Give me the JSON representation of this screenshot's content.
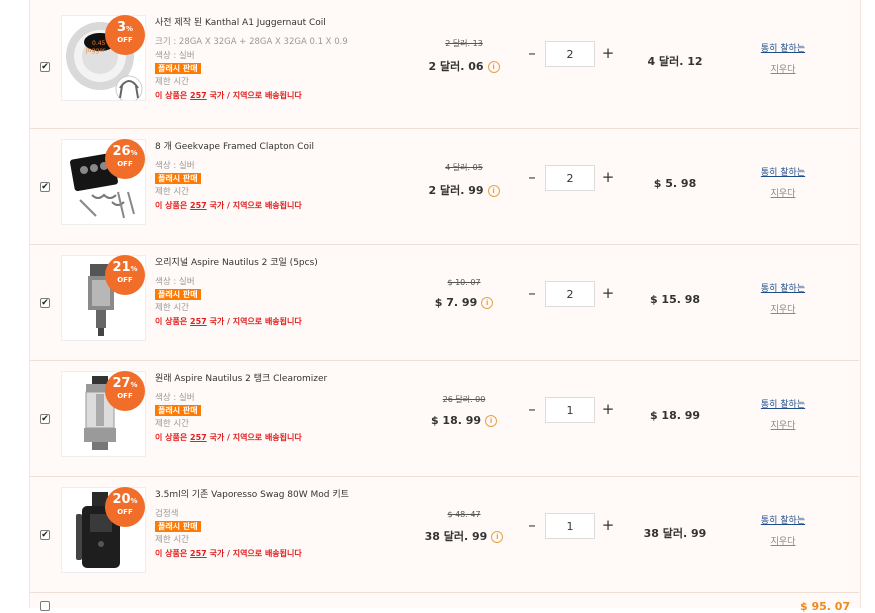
{
  "cart": {
    "items": [
      {
        "discount": "3",
        "pct_sign": "%",
        "off": "OFF",
        "title": "사전 제작 된 Kanthal A1 Juggernaut Coil",
        "meta": [
          "크기 : 28GA X 32GA + 28GA X 32GA 0.1 X 0.9",
          "색상 : 실버"
        ],
        "flash": "플래시 판매",
        "limit": "제한 시간",
        "ship_prefix": "이 상품은 ",
        "ship_count": "257",
        "ship_suffix": " 국가 / 지역으로 배송됩니다",
        "old_price": "2 달러. 13",
        "new_price": "2 달러. 06",
        "qty": "2",
        "subtotal": "4 달러. 12",
        "fav": "통히 찰하는",
        "del": "지우다",
        "checked": true,
        "icon": "coil-spool-icon"
      },
      {
        "discount": "26",
        "pct_sign": "%",
        "off": "OFF",
        "title": "8 개 Geekvape Framed Clapton Coil",
        "meta": [
          "색상 : 실버"
        ],
        "flash": "플래시 판매",
        "limit": "제한 시간",
        "ship_prefix": "이 상품은 ",
        "ship_count": "257",
        "ship_suffix": " 국가 / 지역으로 배송됩니다",
        "old_price": "4 달러. 05",
        "new_price": "2 달러. 99",
        "qty": "2",
        "subtotal": "$ 5. 98",
        "fav": "통히 찰하는",
        "del": "지우다",
        "checked": true,
        "icon": "clapton-coil-pack-icon"
      },
      {
        "discount": "21",
        "pct_sign": "%",
        "off": "OFF",
        "title": "오리지널 Aspire Nautilus 2 코일 (5pcs)",
        "meta": [
          "색상 : 실버"
        ],
        "flash": "플래시 판매",
        "limit": "제한 시간",
        "ship_prefix": "이 상품은 ",
        "ship_count": "257",
        "ship_suffix": " 국가 / 지역으로 배송됩니다",
        "old_price": "$ 10. 07",
        "new_price": "$ 7. 99",
        "qty": "2",
        "subtotal": "$ 15. 98",
        "fav": "통히 찰하는",
        "del": "지우다",
        "checked": true,
        "icon": "coil-head-icon"
      },
      {
        "discount": "27",
        "pct_sign": "%",
        "off": "OFF",
        "title": "원래 Aspire Nautilus 2 탱크 Clearomizer",
        "meta": [
          "색상 : 실버"
        ],
        "flash": "플래시 판매",
        "limit": "제한 시간",
        "ship_prefix": "이 상품은 ",
        "ship_count": "257",
        "ship_suffix": " 국가 / 지역으로 배송됩니다",
        "old_price": "26 달러. 00",
        "new_price": "$ 18. 99",
        "qty": "1",
        "subtotal": "$ 18. 99",
        "fav": "통히 찰하는",
        "del": "지우다",
        "checked": true,
        "icon": "clearomizer-tank-icon"
      },
      {
        "discount": "20",
        "pct_sign": "%",
        "off": "OFF",
        "title": "3.5ml의 기존 Vaporesso Swag 80W Mod 키트",
        "meta": [
          "검정색"
        ],
        "flash": "플래시 판매",
        "limit": "제한 시간",
        "ship_prefix": "이 상품은 ",
        "ship_count": "257",
        "ship_suffix": " 국가 / 지역으로 배송됩니다",
        "old_price": "$ 48. 47",
        "new_price": "38 달러. 99",
        "qty": "1",
        "subtotal": "38 달러. 99",
        "fav": "통히 찰하는",
        "del": "지우다",
        "checked": true,
        "icon": "mod-kit-icon"
      }
    ],
    "controls": {
      "minus": "–",
      "plus": "+",
      "checkmark": "✔",
      "info": "i"
    },
    "footer_total": "$ 95. 07"
  }
}
